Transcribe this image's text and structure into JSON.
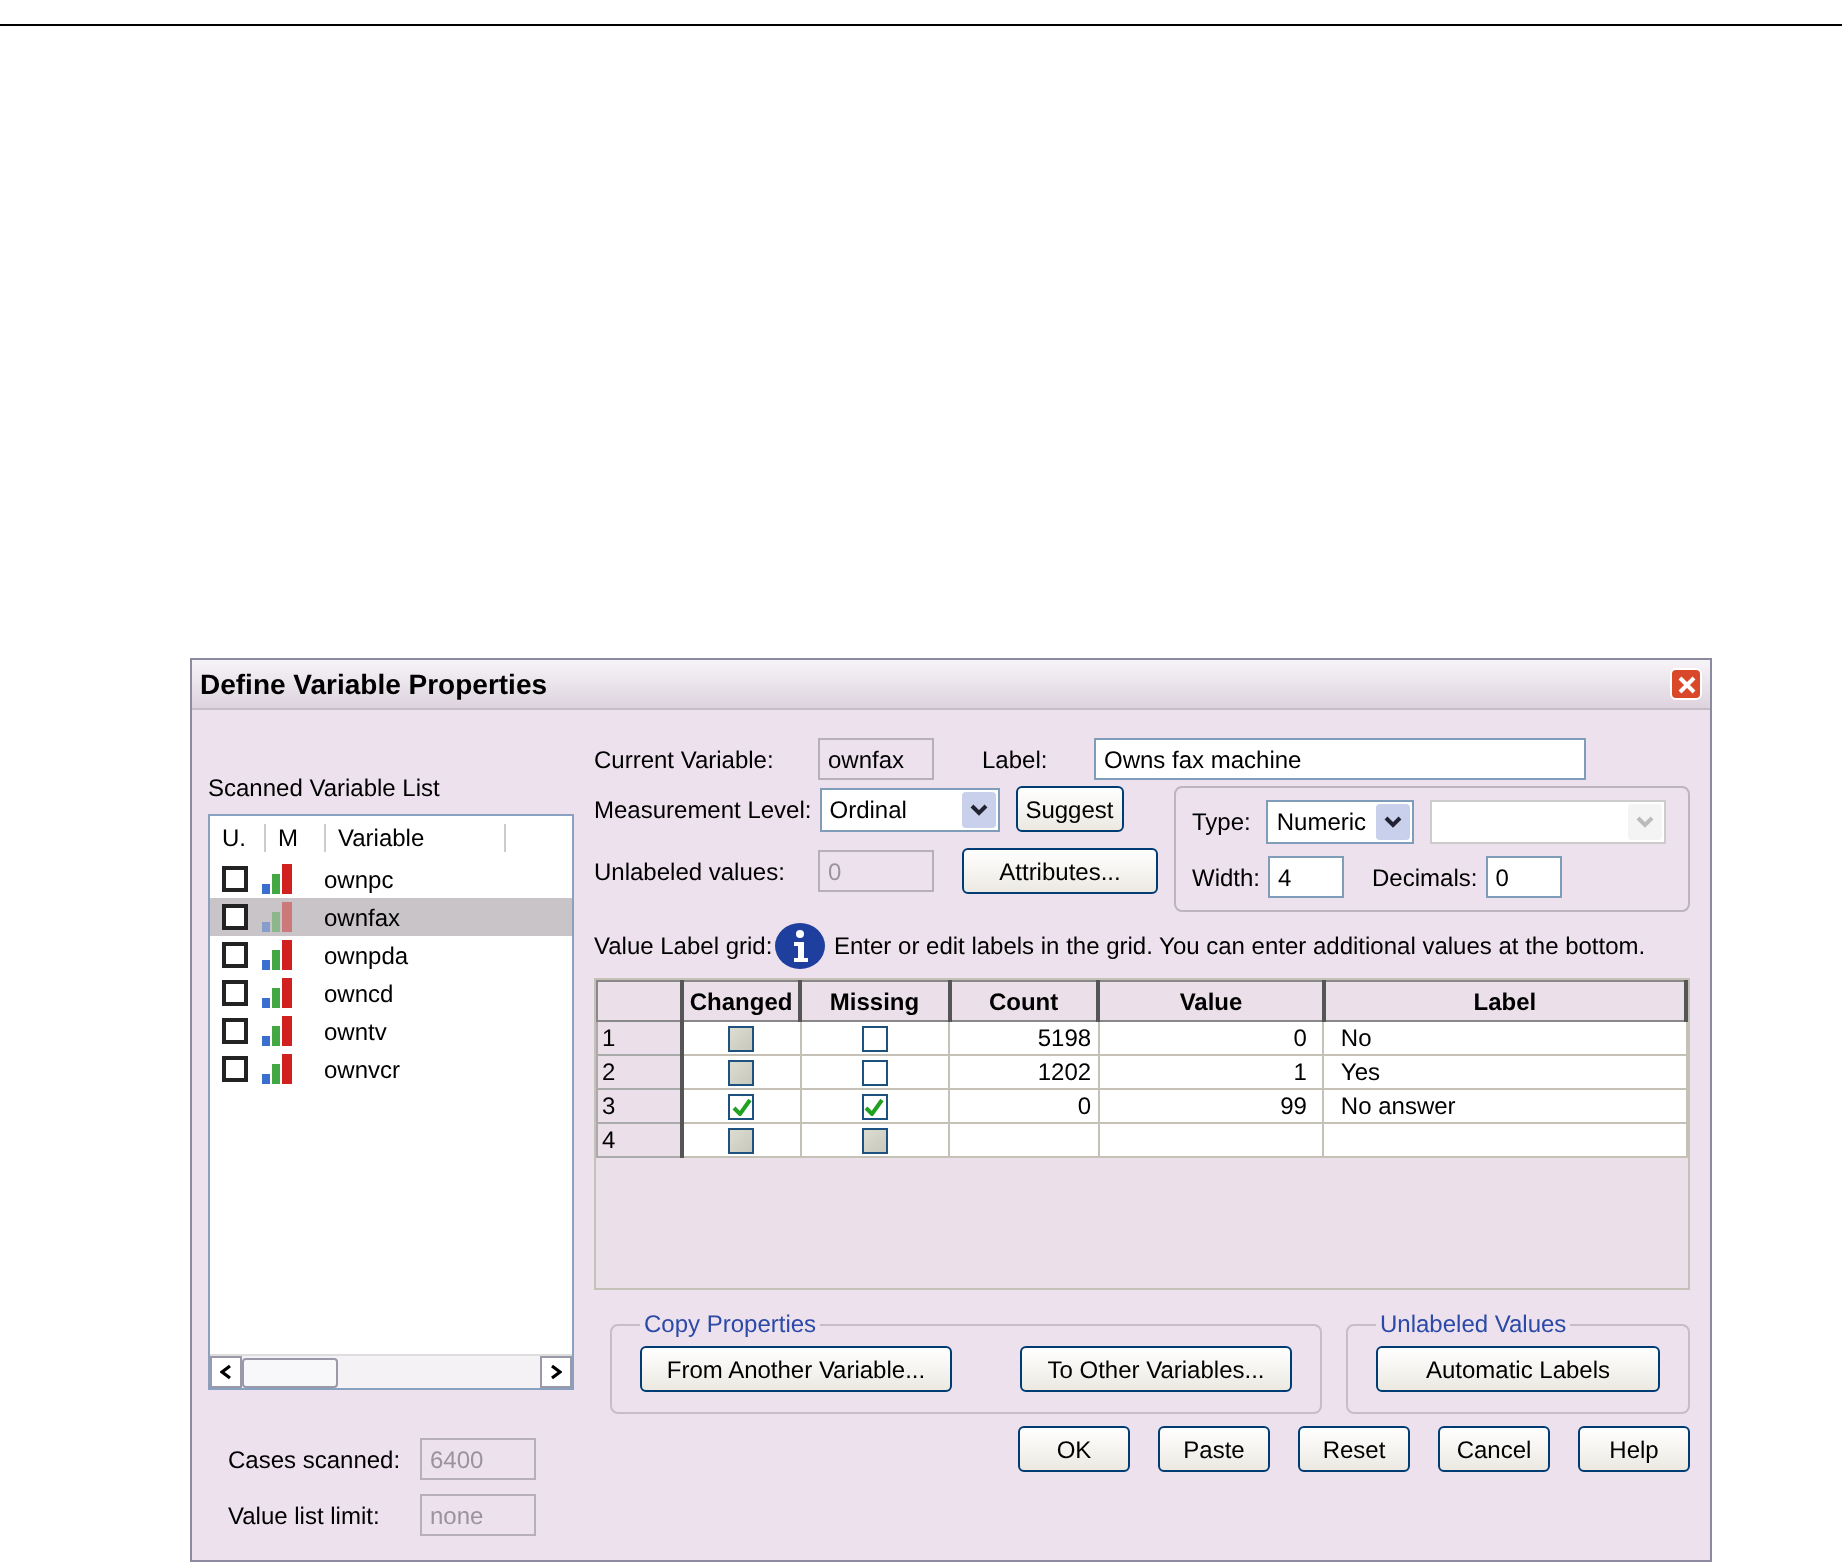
{
  "window": {
    "title": "Define Variable Properties"
  },
  "scanned_list": {
    "title": "Scanned Variable List",
    "columns": [
      "U.",
      "M",
      "Variable"
    ],
    "variables": [
      {
        "name": "ownpc",
        "checked": false,
        "selected": false
      },
      {
        "name": "ownfax",
        "checked": false,
        "selected": true
      },
      {
        "name": "ownpda",
        "checked": false,
        "selected": false
      },
      {
        "name": "owncd",
        "checked": false,
        "selected": false
      },
      {
        "name": "owntv",
        "checked": false,
        "selected": false
      },
      {
        "name": "ownvcr",
        "checked": false,
        "selected": false
      }
    ]
  },
  "cases_scanned": {
    "label": "Cases scanned:",
    "value": "6400"
  },
  "value_list_limit": {
    "label": "Value list limit:",
    "value": "none"
  },
  "current_variable": {
    "label": "Current Variable:",
    "value": "ownfax"
  },
  "label_field": {
    "label": "Label:",
    "value": "Owns fax machine"
  },
  "measurement_level": {
    "label": "Measurement Level:",
    "value": "Ordinal"
  },
  "suggest_button": "Suggest",
  "unlabeled_values": {
    "label": "Unlabeled values:",
    "value": "0"
  },
  "attributes_button": "Attributes...",
  "type": {
    "label": "Type:",
    "value": "Numeric"
  },
  "width": {
    "label": "Width:",
    "value": "4"
  },
  "decimals": {
    "label": "Decimals:",
    "value": "0"
  },
  "grid_label": "Value Label grid:",
  "grid_hint": "Enter or edit labels in the grid.  You can enter additional values at the bottom.",
  "grid": {
    "columns": [
      "Changed",
      "Missing",
      "Count",
      "Value",
      "Label"
    ],
    "rows": [
      {
        "row": "1",
        "changed": {
          "checked": false,
          "disabled": true
        },
        "missing": {
          "checked": false,
          "disabled": false
        },
        "count": "5198",
        "value": "0",
        "label": "No"
      },
      {
        "row": "2",
        "changed": {
          "checked": false,
          "disabled": true
        },
        "missing": {
          "checked": false,
          "disabled": false
        },
        "count": "1202",
        "value": "1",
        "label": "Yes"
      },
      {
        "row": "3",
        "changed": {
          "checked": true,
          "disabled": false
        },
        "missing": {
          "checked": true,
          "disabled": false
        },
        "count": "0",
        "value": "99",
        "label": "No answer"
      },
      {
        "row": "4",
        "changed": {
          "checked": false,
          "disabled": true
        },
        "missing": {
          "checked": false,
          "disabled": true
        }
      }
    ]
  },
  "copy_properties": {
    "title": "Copy Properties",
    "buttons": [
      "From Another Variable...",
      "To Other Variables..."
    ]
  },
  "unlabeled_group": {
    "title": "Unlabeled Values",
    "buttons": [
      "Automatic Labels"
    ]
  },
  "buttons": [
    "OK",
    "Paste",
    "Reset",
    "Cancel",
    "Help"
  ]
}
